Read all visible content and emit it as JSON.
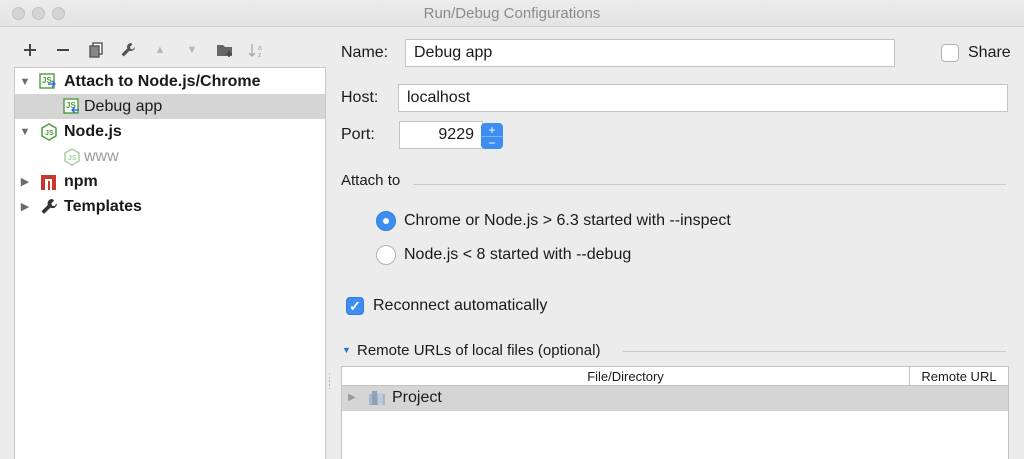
{
  "window": {
    "title": "Run/Debug Configurations"
  },
  "toolbar": {
    "buttons": [
      "add-icon",
      "remove-icon",
      "copy-icon",
      "wrench-icon",
      "move-up-icon",
      "move-down-icon",
      "new-folder-icon",
      "sort-icon"
    ]
  },
  "tree": {
    "items": [
      {
        "label": "Attach to Node.js/Chrome",
        "icon": "attach-nodejs-icon",
        "expanded": true,
        "bold": true
      },
      {
        "label": "Debug app",
        "icon": "attach-config-icon",
        "selected": true
      },
      {
        "label": "Node.js",
        "icon": "nodejs-icon",
        "expanded": true,
        "bold": true
      },
      {
        "label": "www",
        "icon": "nodejs-config-icon",
        "disabled": true
      },
      {
        "label": "npm",
        "icon": "npm-icon",
        "expanded": false,
        "bold": true
      },
      {
        "label": "Templates",
        "icon": "wrench-icon",
        "expanded": false,
        "bold": true
      }
    ]
  },
  "form": {
    "name_label": "Name:",
    "name_value": "Debug app",
    "share_label": "Share",
    "share_checked": false,
    "host_label": "Host:",
    "host_value": "localhost",
    "port_label": "Port:",
    "port_value": "9229",
    "attach_to_label": "Attach to",
    "attach_options": [
      {
        "label": "Chrome or Node.js > 6.3 started with --inspect",
        "selected": true
      },
      {
        "label": "Node.js < 8 started with --debug",
        "selected": false
      }
    ],
    "reconnect_label": "Reconnect automatically",
    "reconnect_checked": true,
    "remote_urls_label": "Remote URLs of local files (optional)",
    "table": {
      "columns": [
        "File/Directory",
        "Remote URL"
      ],
      "rows": [
        {
          "file": "Project",
          "icon": "folder-icon",
          "remote": ""
        }
      ]
    }
  },
  "colors": {
    "accent": "#3d8ef0",
    "selection": "#d5d5d5"
  }
}
